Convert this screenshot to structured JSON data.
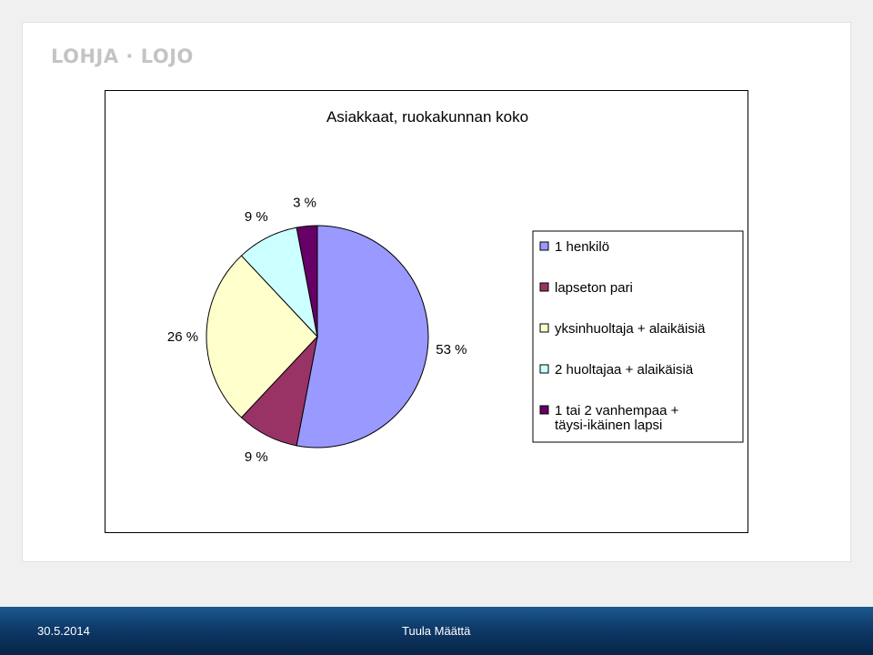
{
  "logo": {
    "text": "LOHJA · LOJO"
  },
  "footer": {
    "date": "30.5.2014",
    "author": "Tuula Määttä"
  },
  "chart_data": {
    "type": "pie",
    "title": "Asiakkaat, ruokakunnan koko",
    "legend_position": "right",
    "slices": [
      {
        "label": "1 henkilö",
        "value": 53,
        "value_label": "53 %",
        "color": "#9999ff"
      },
      {
        "label": "lapseton pari",
        "value": 9,
        "value_label": "9 %",
        "color": "#993366"
      },
      {
        "label": "yksinhuoltaja + alaikäisiä",
        "value": 26,
        "value_label": "26 %",
        "color": "#ffffcc"
      },
      {
        "label": "2 huoltajaa + alaikäisiä",
        "value": 9,
        "value_label": "9 %",
        "color": "#ccffff"
      },
      {
        "label": "1 tai 2 vanhempaa + täysi-ikäinen lapsi",
        "label_lines": [
          "1 tai 2 vanhempaa +",
          "täysi-ikäinen lapsi"
        ],
        "value": 3,
        "value_label": "3 %",
        "color": "#660066"
      }
    ]
  }
}
